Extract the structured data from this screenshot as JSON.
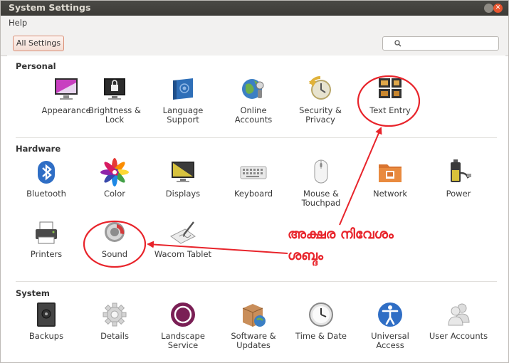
{
  "window": {
    "title": "System Settings"
  },
  "menu": {
    "help": "Help"
  },
  "toolbar": {
    "all_settings": "All Settings",
    "search_placeholder": ""
  },
  "sections": {
    "personal": "Personal",
    "hardware": "Hardware",
    "system": "System"
  },
  "personal_items": [
    {
      "l1": "Appearance",
      "l2": "",
      "icon": "appearance-icon"
    },
    {
      "l1": "Brightness &",
      "l2": "Lock",
      "icon": "brightness-lock-icon"
    },
    {
      "l1": "Language",
      "l2": "Support",
      "icon": "language-support-icon"
    },
    {
      "l1": "Online",
      "l2": "Accounts",
      "icon": "online-accounts-icon"
    },
    {
      "l1": "Security &",
      "l2": "Privacy",
      "icon": "security-privacy-icon"
    },
    {
      "l1": "Text Entry",
      "l2": "",
      "icon": "text-entry-icon"
    }
  ],
  "hardware_items": [
    {
      "l1": "Bluetooth",
      "l2": "",
      "icon": "bluetooth-icon"
    },
    {
      "l1": "Color",
      "l2": "",
      "icon": "color-icon"
    },
    {
      "l1": "Displays",
      "l2": "",
      "icon": "displays-icon"
    },
    {
      "l1": "Keyboard",
      "l2": "",
      "icon": "keyboard-icon"
    },
    {
      "l1": "Mouse &",
      "l2": "Touchpad",
      "icon": "mouse-touchpad-icon"
    },
    {
      "l1": "Network",
      "l2": "",
      "icon": "network-icon"
    },
    {
      "l1": "Power",
      "l2": "",
      "icon": "power-icon"
    },
    {
      "l1": "Printers",
      "l2": "",
      "icon": "printers-icon"
    },
    {
      "l1": "Sound",
      "l2": "",
      "icon": "sound-icon"
    },
    {
      "l1": "Wacom Tablet",
      "l2": "",
      "icon": "wacom-tablet-icon"
    }
  ],
  "system_items": [
    {
      "l1": "Backups",
      "l2": "",
      "icon": "backups-icon"
    },
    {
      "l1": "Details",
      "l2": "",
      "icon": "details-icon"
    },
    {
      "l1": "Landscape",
      "l2": "Service",
      "icon": "landscape-service-icon"
    },
    {
      "l1": "Software &",
      "l2": "Updates",
      "icon": "software-updates-icon"
    },
    {
      "l1": "Time & Date",
      "l2": "",
      "icon": "time-date-icon"
    },
    {
      "l1": "Universal",
      "l2": "Access",
      "icon": "universal-access-icon"
    },
    {
      "l1": "User Accounts",
      "l2": "",
      "icon": "user-accounts-icon"
    }
  ],
  "annotations": {
    "text_entry": "അക്ഷര നിവേശം",
    "sound": "ശബ്ദം",
    "color": "#e8242b"
  }
}
